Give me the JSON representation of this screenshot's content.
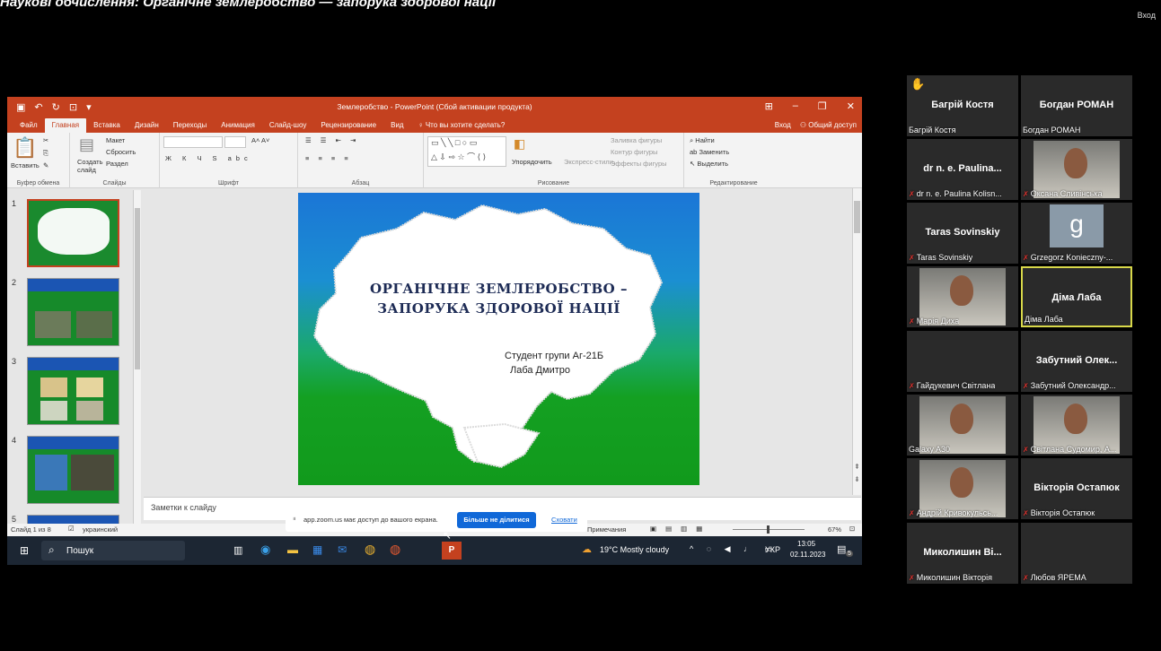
{
  "caption": "Наукові обчислення: Органічне землеробство — запорука здорової нації",
  "zoom": {
    "sign_in": "Вход"
  },
  "ppt": {
    "title": "Землеробство - PowerPoint (Сбой активации продукта)",
    "sign_in": "Вход",
    "share": "Общий доступ",
    "tell_me": "Что вы хотите сделать?",
    "tabs": [
      "Файл",
      "Главная",
      "Вставка",
      "Дизайн",
      "Переходы",
      "Анимация",
      "Слайд-шоу",
      "Рецензирование",
      "Вид"
    ],
    "ribbon": {
      "paste": "Вставить",
      "clipboard": "Буфер обмена",
      "create_slide": "Создать",
      "slide_word": "слайд",
      "layout": "Макет",
      "reset": "Сбросить",
      "section": "Раздел",
      "slides": "Слайды",
      "font": "Шрифт",
      "paragraph": "Абзац",
      "arrange": "Упорядочить",
      "express_styles": "Экспресс-стили",
      "fill": "Заливка фигуры",
      "outline": "Контур фигуры",
      "effects": "Эффекты фигуры",
      "drawing": "Рисование",
      "find": "Найти",
      "replace": "Заменить",
      "select": "Выделить",
      "editing": "Редактирование"
    },
    "slide": {
      "title_line1": "ОРГАНІЧНЕ ЗЕМЛЕРОБСТВО –",
      "title_line2": "ЗАПОРУКА ЗДОРОВОЇ НАЦІЇ",
      "sub_line1": "Студент групи Аг-21Б",
      "sub_line2": "Лаба Дмитро"
    },
    "thumb_numbers": [
      "1",
      "2",
      "3",
      "4",
      "5"
    ],
    "notes_placeholder": "Заметки к слайду",
    "status": {
      "slide": "Слайд 1 из 8",
      "lang": "украинский",
      "notes": "Примечания",
      "zoom": "67%"
    },
    "taskbar": {
      "search": "Пошук",
      "weather": "19°C  Mostly cloudy",
      "lang": "УКР",
      "time": "13:05",
      "date": "02.11.2023",
      "notif": "5"
    }
  },
  "share_banner": {
    "text": "app.zoom.us має доступ до вашого екрана.",
    "stop": "Більше не ділитися",
    "hide": "Сховати"
  },
  "participants": [
    {
      "name": "Багрій Костя",
      "label": "Багрій Костя",
      "muted": false,
      "hand": true,
      "video": false
    },
    {
      "name": "Богдан РОМАН",
      "label": "Богдан РОМАН",
      "muted": false,
      "video": false
    },
    {
      "name": "dr n. e. Paulina...",
      "label": "dr n. e. Paulina Kolisn...",
      "muted": true,
      "video": false
    },
    {
      "name": "",
      "label": "Оксана Сливінська",
      "muted": true,
      "video": true
    },
    {
      "name": "Taras Sovinskiy",
      "label": "Taras Sovinskiy",
      "muted": true,
      "video": false
    },
    {
      "name": "",
      "label": "Grzegorz Konieczny-...",
      "muted": true,
      "video": false,
      "avatar": "g"
    },
    {
      "name": "",
      "label": "Марія Диха",
      "muted": true,
      "video": true
    },
    {
      "name": "Діма Лаба",
      "label": "Діма Лаба",
      "muted": false,
      "video": false,
      "speaking": true
    },
    {
      "name": "",
      "label": "Гайдукевич Світлана",
      "muted": true,
      "video": false
    },
    {
      "name": "Забутний Олек...",
      "label": "Забутний Олександр...",
      "muted": true,
      "video": false
    },
    {
      "name": "",
      "label": "Galaxy A30",
      "muted": false,
      "video": true
    },
    {
      "name": "",
      "label": "Світлана Судомир, А...",
      "muted": true,
      "video": true
    },
    {
      "name": "",
      "label": "Андрій Кривокульсь...",
      "muted": true,
      "video": true
    },
    {
      "name": "Вікторія Остапюк",
      "label": "Вікторія Остапюк",
      "muted": true,
      "video": false
    },
    {
      "name": "Миколишин Ві...",
      "label": "Миколишин Вікторія",
      "muted": true,
      "video": false
    },
    {
      "name": "",
      "label": "Любов ЯРЕМА",
      "muted": true,
      "video": false
    }
  ],
  "colors": {
    "ppt_accent": "#c4411f",
    "zoom_blue": "#1068d8",
    "speaker_border": "#d8d84a",
    "mute_red": "#e0332f"
  }
}
